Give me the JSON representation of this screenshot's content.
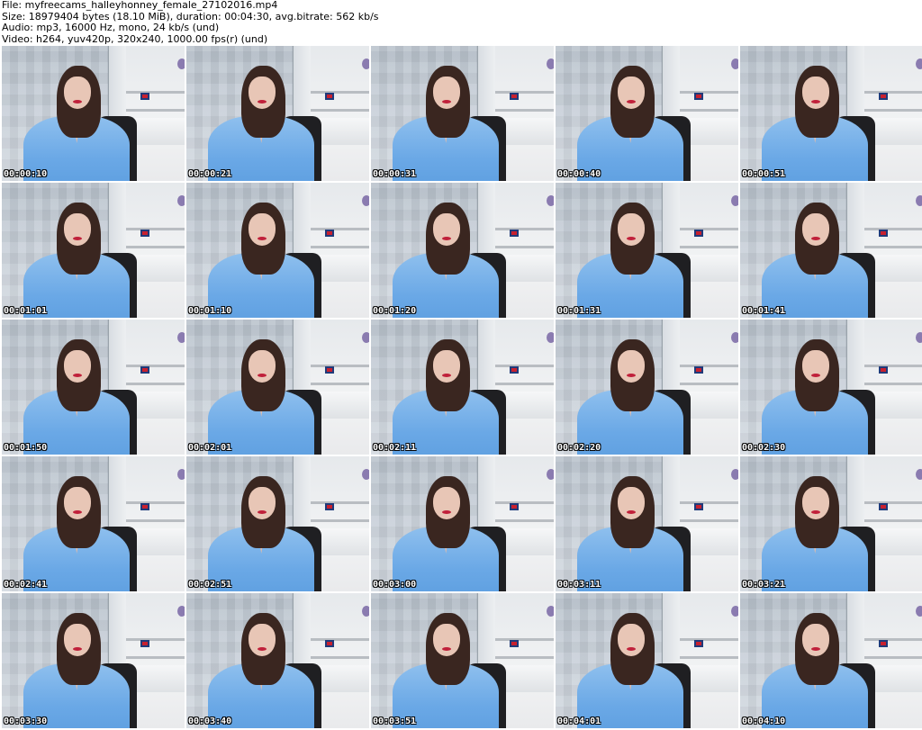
{
  "header": {
    "line1": "File: myfreecams_halleyhonney_female_27102016.mp4",
    "line2": "Size: 18979404 bytes (18.10 MiB), duration: 00:04:30, avg.bitrate: 562 kb/s",
    "line3": "Audio: mp3, 16000 Hz, mono, 24 kb/s (und)",
    "line4": "Video: h264, yuv420p, 320x240, 1000.00 fps(r) (und)"
  },
  "thumbnails": [
    "00:00:10",
    "00:00:21",
    "00:00:31",
    "00:00:40",
    "00:00:51",
    "00:01:01",
    "00:01:10",
    "00:01:20",
    "00:01:31",
    "00:01:41",
    "00:01:50",
    "00:02:01",
    "00:02:11",
    "00:02:20",
    "00:02:30",
    "00:02:41",
    "00:02:51",
    "00:03:00",
    "00:03:11",
    "00:03:21",
    "00:03:30",
    "00:03:40",
    "00:03:51",
    "00:04:01",
    "00:04:10"
  ],
  "colors": {
    "shirt": "#6aa8e6",
    "hair": "#3a2620",
    "timestamp_text": "#ffffff",
    "background": "#ffffff"
  }
}
